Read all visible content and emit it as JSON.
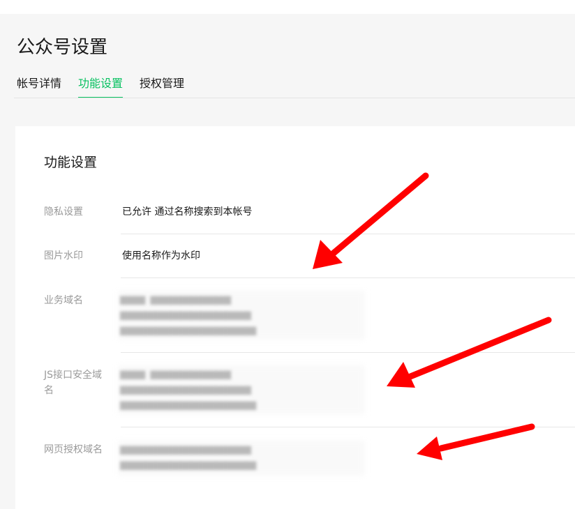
{
  "header": {
    "title": "公众号设置",
    "tabs": [
      {
        "label": "帐号详情",
        "active": false
      },
      {
        "label": "功能设置",
        "active": true
      },
      {
        "label": "授权管理",
        "active": false
      }
    ]
  },
  "section": {
    "title": "功能设置",
    "rows": [
      {
        "label": "隐私设置",
        "value": "已允许 通过名称搜索到本帐号"
      },
      {
        "label": "图片水印",
        "value": "使用名称作为水印"
      },
      {
        "label": "业务域名",
        "value": ""
      },
      {
        "label": "JS接口安全域名",
        "value": ""
      },
      {
        "label": "网页授权域名",
        "value": ""
      }
    ]
  },
  "colors": {
    "accent": "#07c160",
    "annotation_arrow": "#ff0000"
  }
}
